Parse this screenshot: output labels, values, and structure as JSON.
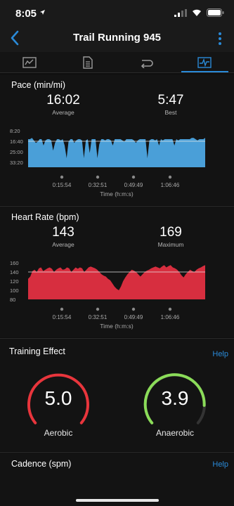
{
  "status_bar": {
    "time": "8:05"
  },
  "nav": {
    "title": "Trail Running 945"
  },
  "tabs": [
    {
      "name": "tab-summary",
      "icon": "summary-icon"
    },
    {
      "name": "tab-details",
      "icon": "document-icon"
    },
    {
      "name": "tab-laps",
      "icon": "laps-icon"
    },
    {
      "name": "tab-charts",
      "icon": "chart-icon",
      "active": true
    }
  ],
  "pace": {
    "title": "Pace (min/mi)",
    "average_value": "16:02",
    "average_label": "Average",
    "best_value": "5:47",
    "best_label": "Best"
  },
  "heart_rate": {
    "title": "Heart Rate (bpm)",
    "average_value": "143",
    "average_label": "Average",
    "max_value": "169",
    "max_label": "Maximum"
  },
  "training_effect": {
    "title": "Training Effect",
    "help": "Help",
    "aerobic_value": "5.0",
    "aerobic_label": "Aerobic",
    "anaerobic_value": "3.9",
    "anaerobic_label": "Anaerobic"
  },
  "cadence": {
    "title": "Cadence (spm)",
    "help": "Help"
  },
  "colors": {
    "pace": "#4a9fd8",
    "heart_rate": "#d72e3f",
    "aerobic": "#e8353c",
    "anaerobic": "#8bdc59",
    "accent": "#2a8ad8"
  },
  "chart_data": [
    {
      "type": "area",
      "title": "Pace (min/mi)",
      "xlabel": "Time (h:m:s)",
      "x_ticks": [
        "0:15:54",
        "0:32:51",
        "0:49:49",
        "1:06:46"
      ],
      "y_ticks": [
        "8:20",
        "16:40",
        "25:00",
        "33:20"
      ],
      "y_reference": "16:40",
      "y_inverted": true,
      "series": [
        {
          "values": [
            15,
            15,
            14,
            16,
            18,
            17,
            15,
            15,
            20,
            16,
            15,
            15,
            16,
            24,
            18,
            15,
            15,
            16,
            15,
            20,
            30,
            17,
            15,
            15,
            18,
            16,
            15,
            15,
            16,
            30,
            16,
            15,
            26,
            15,
            15,
            15,
            30,
            19,
            15,
            15,
            16,
            15,
            15,
            16,
            20,
            15,
            15,
            15,
            15,
            16,
            17,
            15,
            15,
            15,
            15,
            16,
            18,
            16,
            15,
            15,
            15,
            15,
            30,
            16,
            15,
            15,
            16,
            15,
            20,
            15,
            16,
            15,
            15,
            15,
            15,
            15,
            20,
            15,
            16,
            15,
            15,
            15,
            15,
            15,
            15,
            14,
            14,
            15,
            16,
            15,
            15,
            15,
            14
          ]
        }
      ]
    },
    {
      "type": "area",
      "title": "Heart Rate (bpm)",
      "xlabel": "Time (h:m:s)",
      "x_ticks": [
        "0:15:54",
        "0:32:51",
        "0:49:49",
        "1:06:46"
      ],
      "y_ticks": [
        "160",
        "140",
        "120",
        "100",
        "80"
      ],
      "y_reference": 140,
      "ylim": [
        80,
        165
      ],
      "series": [
        {
          "values": [
            125,
            130,
            142,
            145,
            140,
            148,
            150,
            142,
            145,
            148,
            150,
            147,
            140,
            145,
            148,
            150,
            145,
            146,
            150,
            148,
            140,
            145,
            150,
            147,
            150,
            148,
            140,
            145,
            150,
            152,
            150,
            148,
            145,
            140,
            135,
            132,
            130,
            125,
            122,
            115,
            108,
            103,
            100,
            108,
            120,
            128,
            135,
            140,
            145,
            143,
            140,
            135,
            130,
            135,
            140,
            143,
            145,
            148,
            150,
            152,
            150,
            148,
            152,
            155,
            150,
            153,
            155,
            150,
            148,
            145,
            140,
            133,
            128,
            135,
            140,
            145,
            142,
            140,
            145,
            148,
            150,
            153,
            155
          ]
        }
      ]
    }
  ]
}
